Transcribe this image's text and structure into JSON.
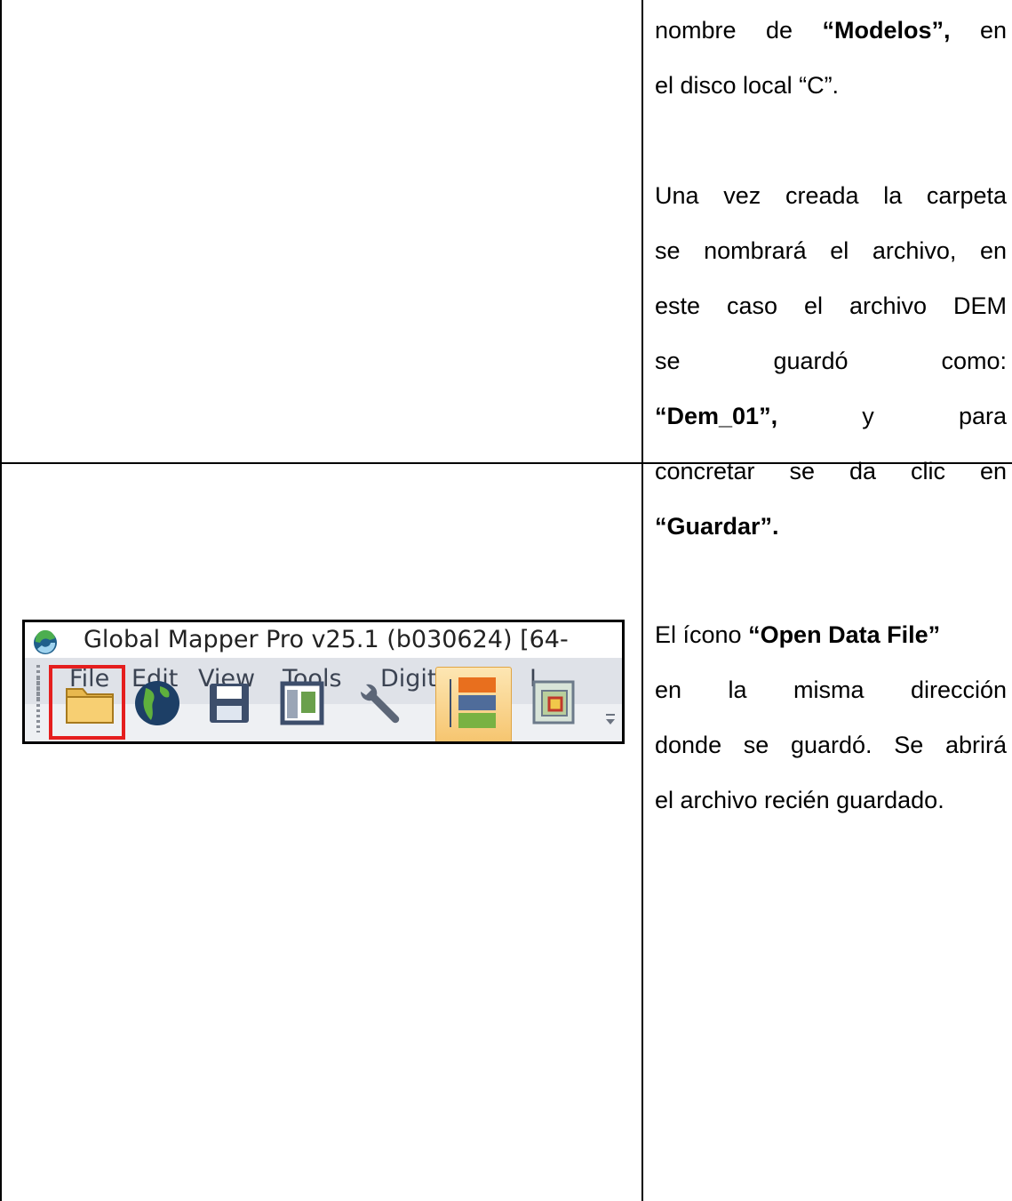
{
  "row1": {
    "lines": [
      {
        "pre": "nombre de ",
        "bold": "“Modelos”,",
        "post": " en"
      },
      {
        "pre": "el disco local “C”.",
        "bold": "",
        "post": ""
      },
      {
        "pre": "",
        "bold": "",
        "post": ""
      },
      {
        "pre": "Una vez creada la carpeta",
        "bold": "",
        "post": ""
      },
      {
        "pre": "se nombrará el archivo, en",
        "bold": "",
        "post": ""
      },
      {
        "pre": "este caso el archivo DEM",
        "bold": "",
        "post": ""
      },
      {
        "pre": "se guardó como:",
        "bold": "",
        "post": ""
      },
      {
        "pre": "",
        "bold": "“Dem_01”,",
        "post": " y para"
      },
      {
        "pre": "concretar se da clic en",
        "bold": "",
        "post": ""
      },
      {
        "pre": "",
        "bold": "“Guardar”.",
        "post": ""
      }
    ]
  },
  "row2": {
    "lines": [
      {
        "pre": "El ícono ",
        "bold": "“Open Data File”",
        "post": ""
      },
      {
        "pre": "en la misma dirección",
        "bold": "",
        "post": ""
      },
      {
        "pre": "donde se guardó. Se abrirá",
        "bold": "",
        "post": ""
      },
      {
        "pre": "el archivo recién guardado.",
        "bold": "",
        "post": ""
      }
    ]
  },
  "screenshot": {
    "title": "Global Mapper Pro v25.1 (b030624) [64-",
    "menu": [
      "File",
      "Edit",
      "View",
      "Tools",
      "Digitizer",
      "L"
    ],
    "toolbar_icons": [
      "open-folder-icon",
      "globe-icon",
      "save-icon",
      "window-icon",
      "wrench-icon",
      "layers-icon",
      "overview-icon"
    ],
    "selection_color": "#e51e1e"
  }
}
